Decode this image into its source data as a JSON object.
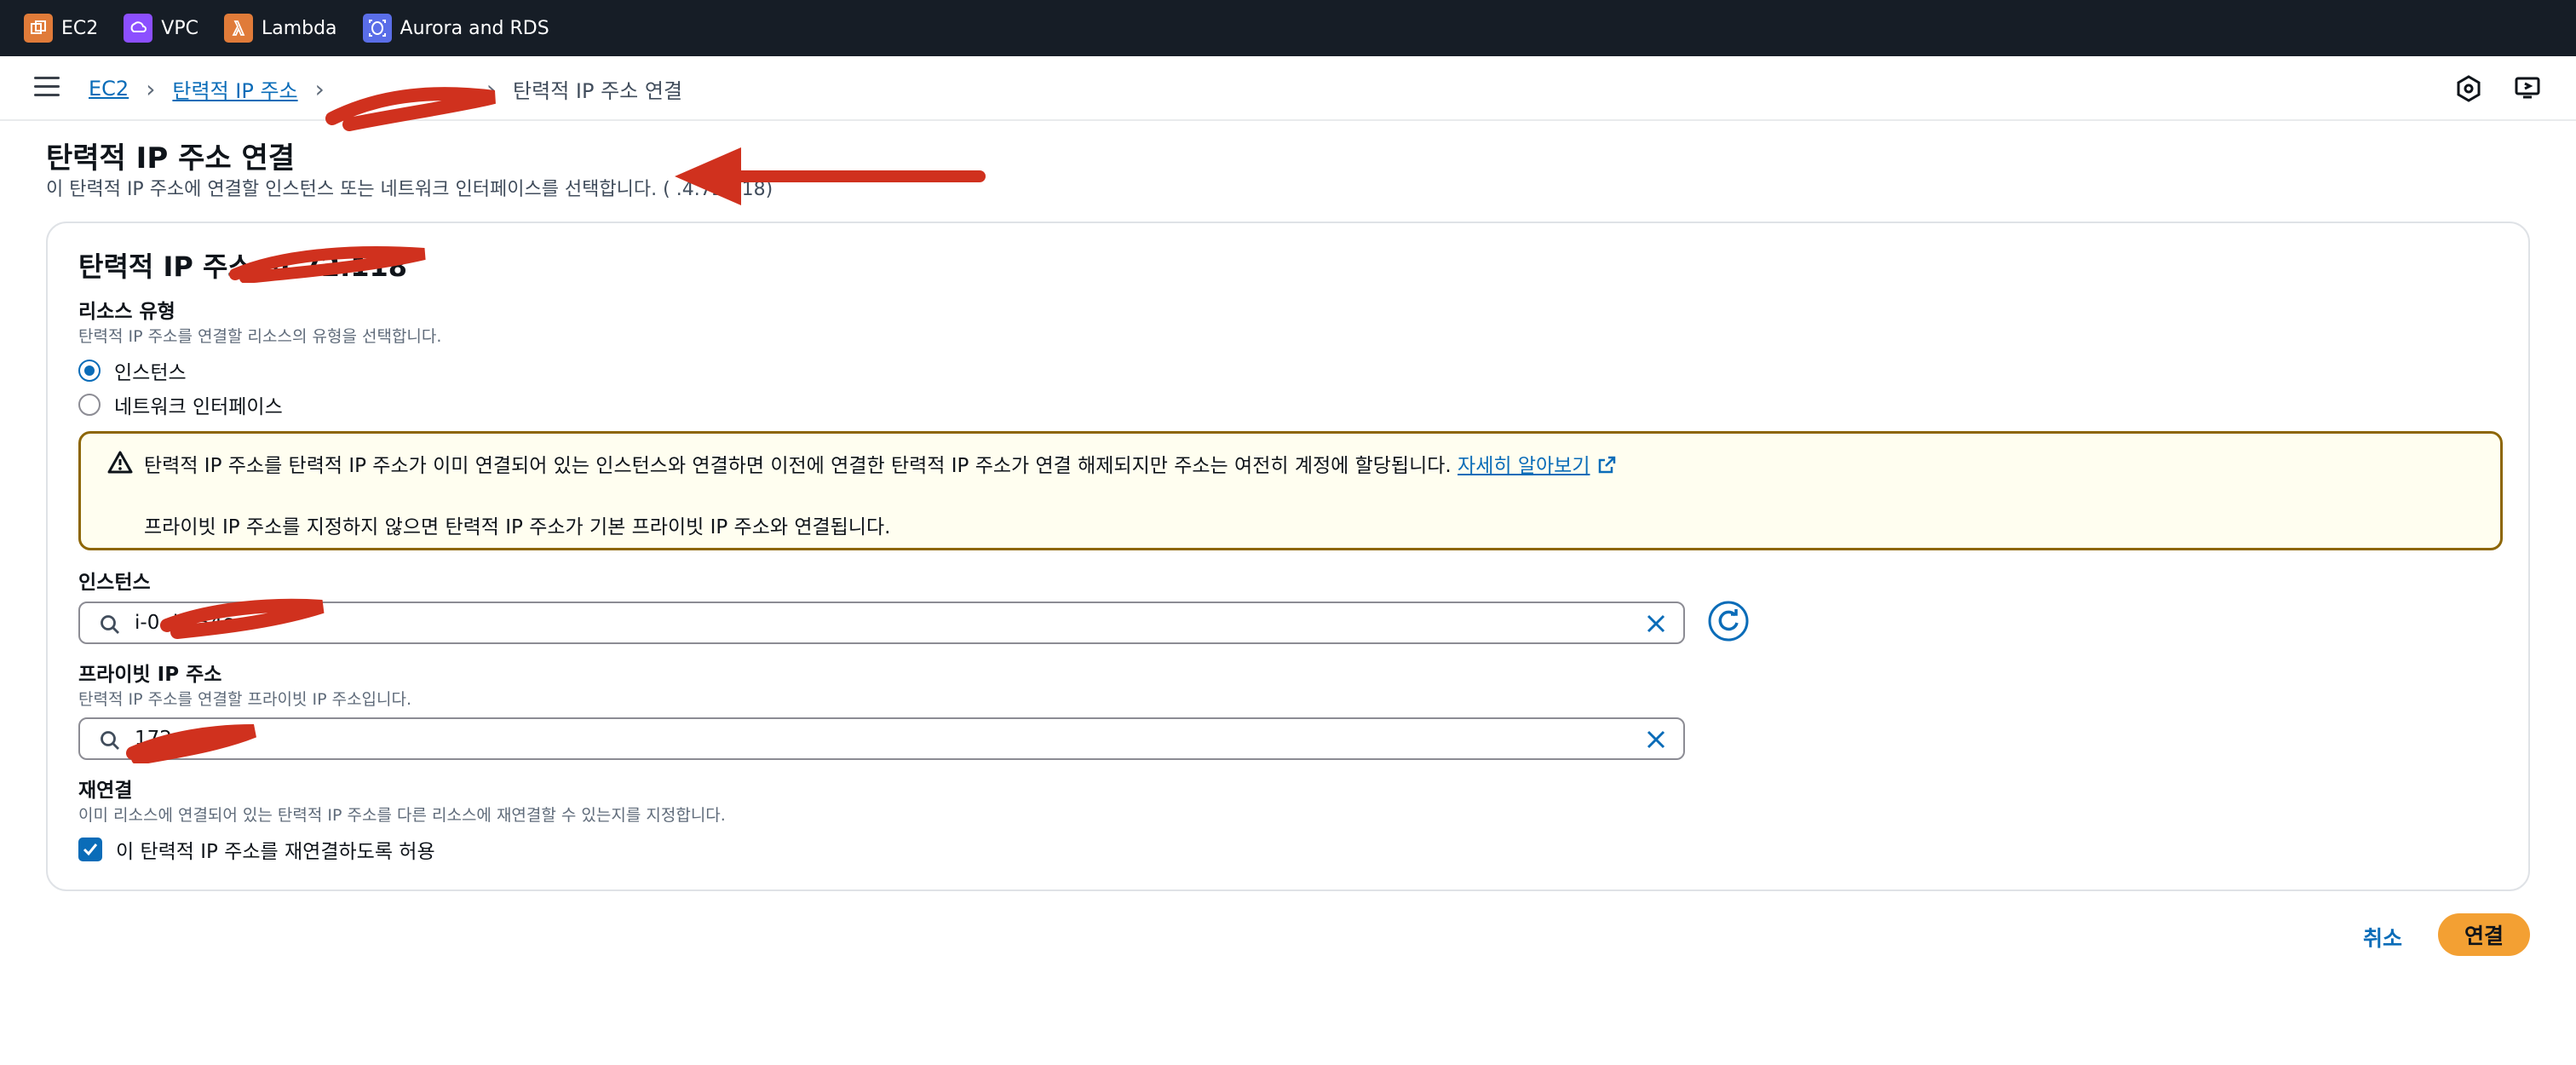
{
  "topbar": {
    "favorites": [
      {
        "label": "EC2",
        "icon": "ec2-icon",
        "color": "#e07b39"
      },
      {
        "label": "VPC",
        "icon": "vpc-icon",
        "color": "#8c4fff"
      },
      {
        "label": "Lambda",
        "icon": "lambda-icon",
        "color": "#e07b39"
      },
      {
        "label": "Aurora and RDS",
        "icon": "rds-icon",
        "color": "#5a6ee8"
      }
    ]
  },
  "breadcrumb": {
    "items": [
      "EC2",
      "탄력적 IP 주소"
    ],
    "current": "탄력적 IP 주소 연결"
  },
  "page": {
    "title": "탄력적 IP 주소 연결",
    "description": "이 탄력적 IP 주소에 연결할 인스턴스 또는 네트워크 인터페이스를 선택합니다. (   .4.72.118)"
  },
  "panel": {
    "title": "탄력적 IP 주소      .4.72.118",
    "resource_type": {
      "label": "리소스 유형",
      "description": "탄력적 IP 주소를 연결할 리소스의 유형을 선택합니다.",
      "options": [
        "인스턴스",
        "네트워크 인터페이스"
      ],
      "selected": "인스턴스"
    },
    "alert": {
      "line1": "탄력적 IP 주소를 탄력적 IP 주소가 이미 연결되어 있는 인스턴스와 연결하면 이전에 연결한 탄력적 IP 주소가 연결 해제되지만 주소는 여전히 계정에 할당됩니다.",
      "link": "자세히 알아보기",
      "line2": "프라이빗 IP 주소를 지정하지 않으면 탄력적 IP 주소가 기본 프라이빗 IP 주소와 연결됩니다."
    },
    "instance": {
      "label": "인스턴스",
      "value": "i-0              df934c"
    },
    "private_ip": {
      "label": "프라이빗 IP 주소",
      "description": "탄력적 IP 주소를 연결할 프라이빗 IP 주소입니다.",
      "value": "172         .240"
    },
    "reassociation": {
      "label": "재연결",
      "description": "이미 리소스에 연결되어 있는 탄력적 IP 주소를 다른 리소스에 재연결할 수 있는지를 지정합니다.",
      "checkbox_label": "이 탄력적 IP 주소를 재연결하도록 허용",
      "checked": true
    }
  },
  "actions": {
    "cancel": "취소",
    "submit": "연결"
  },
  "colors": {
    "link": "#0a6cb8",
    "primary_button": "#f3a033",
    "alert_border": "#8d6605",
    "annotation_red": "#d0311e"
  }
}
